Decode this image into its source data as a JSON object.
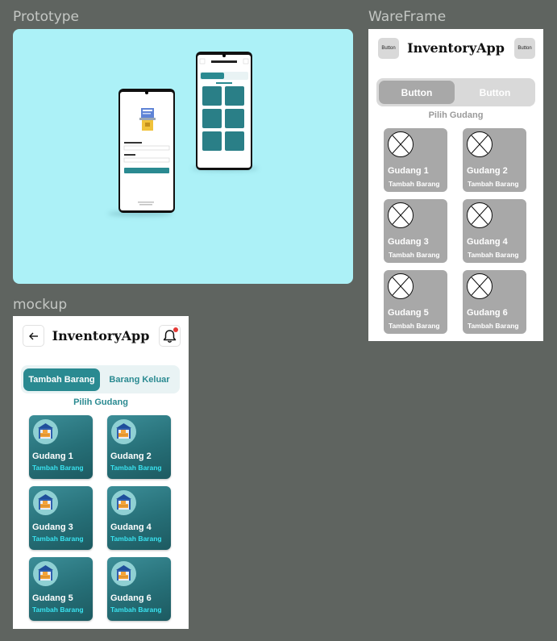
{
  "labels": {
    "prototype": "Prototype",
    "wireframe": "WareFrame",
    "mockup": "mockup"
  },
  "wireframe": {
    "left_button": "Button",
    "right_button": "Button",
    "title": "InventoryApp",
    "tab_active": "Button",
    "tab_inactive": "Button",
    "subtitle": "Pilih Gudang",
    "cards": [
      {
        "name": "Gudang 1",
        "action": "Tambah Barang"
      },
      {
        "name": "Gudang 2",
        "action": "Tambah Barang"
      },
      {
        "name": "Gudang 3",
        "action": "Tambah Barang"
      },
      {
        "name": "Gudang 4",
        "action": "Tambah Barang"
      },
      {
        "name": "Gudang 5",
        "action": "Tambah Barang"
      },
      {
        "name": "Gudang 6",
        "action": "Tambah Barang"
      }
    ]
  },
  "mockup": {
    "back_icon": "arrow-left-icon",
    "bell_icon": "bell-icon",
    "title": "InventoryApp",
    "tab_active": "Tambah Barang",
    "tab_inactive": "Barang Keluar",
    "subtitle": "Pilih Gudang",
    "cards": [
      {
        "name": "Gudang 1",
        "action": "Tambah Barang"
      },
      {
        "name": "Gudang 2",
        "action": "Tambah Barang"
      },
      {
        "name": "Gudang 3",
        "action": "Tambah Barang"
      },
      {
        "name": "Gudang 4",
        "action": "Tambah Barang"
      },
      {
        "name": "Gudang 5",
        "action": "Tambah Barang"
      },
      {
        "name": "Gudang 6",
        "action": "Tambah Barang"
      }
    ]
  },
  "colors": {
    "canvas": "#5f6460",
    "prototype_bg": "#acf1f7",
    "accent": "#2a8a91",
    "accent_light": "#39e3f0",
    "notification": "#e53935",
    "wireframe_gray": "#a8a8a8"
  }
}
